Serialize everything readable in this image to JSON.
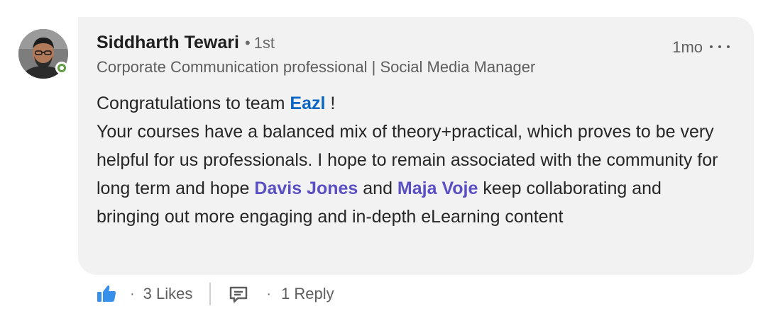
{
  "comment": {
    "author": {
      "name": "Siddharth Tewari",
      "degree_separator": "•",
      "degree": "1st",
      "headline": "Corporate Communication professional | Social Media Manager",
      "avatar_icon": "profile-photo",
      "presence_color": "#5f9b41"
    },
    "timestamp": "1mo",
    "more_icon": "ellipsis-icon",
    "body": {
      "line1_prefix": "Congratulations to team ",
      "company_mention": "Eazl",
      "line1_suffix": " !",
      "para2_part1": "Your courses have a balanced mix of theory+practical, which proves to be very helpful for us professionals. I hope to remain associated with the community for long term and hope ",
      "mention1": "Davis Jones",
      "para2_and": " and ",
      "mention2": "Maja Voje",
      "para2_part2": " keep collaborating and bringing out more engaging and in-depth eLearning content"
    },
    "actions": {
      "like_icon": "thumbs-up-icon",
      "likes_sep": "·",
      "likes_label": "3 Likes",
      "reply_icon": "comment-icon",
      "reply_sep": "·",
      "reply_label": "1 Reply"
    },
    "colors": {
      "bubble_bg": "#f2f2f2",
      "company_mention": "#0a66c2",
      "person_mention": "#5b4fc4",
      "like_blue": "#378fe9"
    }
  }
}
